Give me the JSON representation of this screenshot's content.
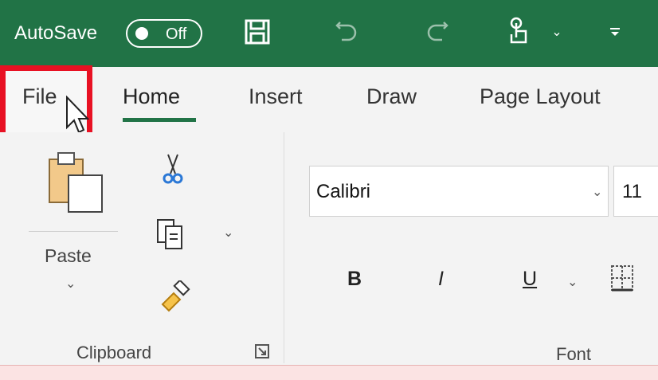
{
  "qat": {
    "autosave_label": "AutoSave",
    "autosave_state": "Off",
    "icons": [
      "save-icon",
      "undo-icon",
      "redo-icon",
      "touch-mode-icon",
      "chevron-down-icon",
      "customize-qat-icon"
    ]
  },
  "tabs": [
    {
      "label": "File",
      "selected": false,
      "highlighted": true
    },
    {
      "label": "Home",
      "selected": true
    },
    {
      "label": "Insert",
      "selected": false
    },
    {
      "label": "Draw",
      "selected": false
    },
    {
      "label": "Page Layout",
      "selected": false
    }
  ],
  "clipboard": {
    "paste_label": "Paste",
    "group_label": "Clipboard",
    "icons": [
      "paste-icon",
      "cut-icon",
      "copy-icon",
      "format-painter-icon",
      "dialog-launcher-icon"
    ]
  },
  "font": {
    "font_name": "Calibri",
    "font_size": "11",
    "group_label": "Font",
    "bold": "B",
    "italic": "I",
    "underline": "U"
  },
  "colors": {
    "accent": "#217346",
    "highlight": "#e81123",
    "ribbon_bg": "#f3f3f3"
  }
}
